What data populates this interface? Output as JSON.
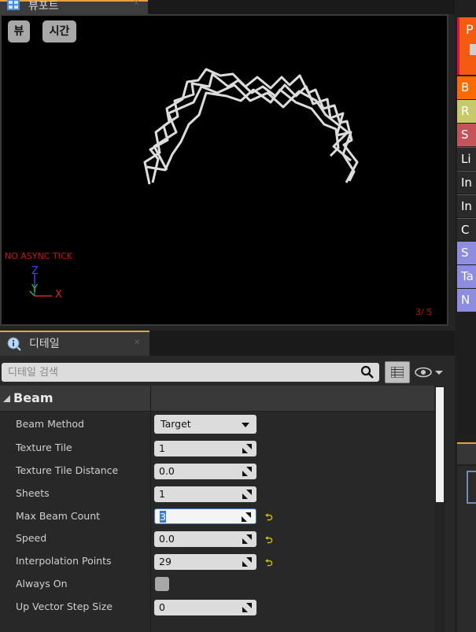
{
  "viewport": {
    "tab_title": "뷰포트",
    "buttons": {
      "view": "뷰",
      "time": "시간"
    },
    "overlay": {
      "warning": "NO ASYNC TICK",
      "frame_counter": "3/  5"
    },
    "axes": {
      "z": "Z",
      "y": "Y",
      "x": "X"
    }
  },
  "details": {
    "tab_title": "디테일",
    "search_placeholder": "디테일 검색",
    "category": "Beam",
    "properties": [
      {
        "label": "Beam Method",
        "value": "Target"
      },
      {
        "label": "Texture Tile",
        "value": "1"
      },
      {
        "label": "Texture Tile Distance",
        "value": "0.0"
      },
      {
        "label": "Sheets",
        "value": "1"
      },
      {
        "label": "Max Beam Count",
        "value": "3"
      },
      {
        "label": "Speed",
        "value": "0.0"
      },
      {
        "label": "Interpolation Points",
        "value": "29"
      },
      {
        "label": "Always On",
        "checked": false
      },
      {
        "label": "Up Vector Step Size",
        "value": "0"
      }
    ]
  },
  "module_stack": {
    "items": [
      {
        "label": "P",
        "color": "#f45a10"
      },
      {
        "label": "B",
        "color": "#ff6a00"
      },
      {
        "label": "R",
        "color": "#c7c96a"
      },
      {
        "label": "S",
        "color": "#c4545a"
      },
      {
        "label": "Li",
        "color": "#2a2a2a"
      },
      {
        "label": "In",
        "color": "#2a2a2a"
      },
      {
        "label": "In",
        "color": "#2a2a2a"
      },
      {
        "label": "C",
        "color": "#2a2a2a"
      },
      {
        "label": "S",
        "color": "#8c8ce0"
      },
      {
        "label": "Ta",
        "color": "#8c8ce0"
      },
      {
        "label": "N",
        "color": "#8c8ce0"
      }
    ]
  },
  "colors": {
    "accent_tab": "#e6a23c",
    "reset_arrow": "#d4c20a",
    "warning": "#d01010"
  }
}
